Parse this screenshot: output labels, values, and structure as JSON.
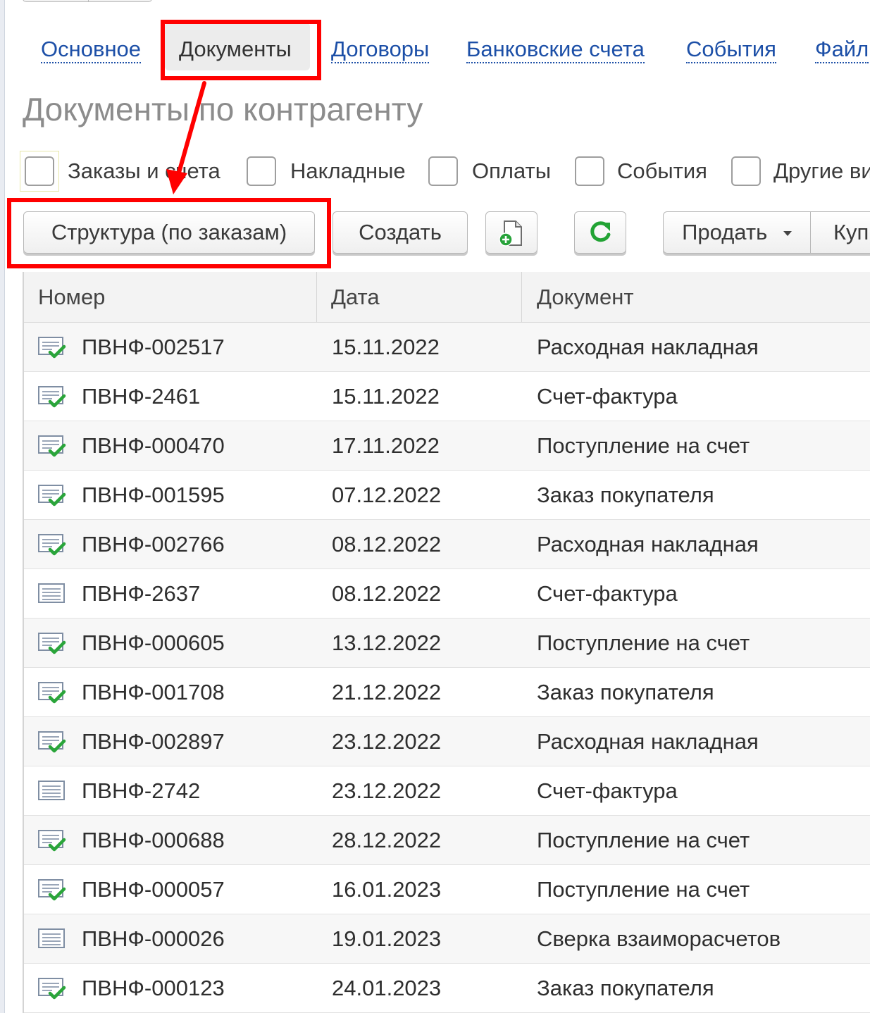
{
  "tabs": {
    "items": [
      {
        "label": "Основное",
        "active": false
      },
      {
        "label": "Документы",
        "active": true
      },
      {
        "label": "Договоры",
        "active": false
      },
      {
        "label": "Банковские счета",
        "active": false
      },
      {
        "label": "События",
        "active": false
      },
      {
        "label": "Файл",
        "active": false
      }
    ]
  },
  "page": {
    "title": "Документы по контрагенту"
  },
  "filters": [
    {
      "label": "Заказы и счета",
      "checked": false
    },
    {
      "label": "Накладные",
      "checked": false
    },
    {
      "label": "Оплаты",
      "checked": false
    },
    {
      "label": "События",
      "checked": false
    },
    {
      "label": "Другие ви",
      "checked": false
    }
  ],
  "toolbar": {
    "structure_label": "Структура (по заказам)",
    "create_label": "Создать",
    "sell_label": "Продать",
    "buy_label": "Куп",
    "sell_icon": "triangle-down",
    "add_icon": "document-plus",
    "refresh_icon": "refresh"
  },
  "table": {
    "columns": [
      "Номер",
      "Дата",
      "Документ"
    ],
    "rows": [
      {
        "icon": "doc-posted",
        "number": "ПВНФ-002517",
        "date": "15.11.2022",
        "document": "Расходная накладная"
      },
      {
        "icon": "doc-posted",
        "number": "ПВНФ-2461",
        "date": "15.11.2022",
        "document": "Счет-фактура"
      },
      {
        "icon": "doc-posted",
        "number": "ПВНФ-000470",
        "date": "17.11.2022",
        "document": "Поступление на счет"
      },
      {
        "icon": "doc-posted",
        "number": "ПВНФ-001595",
        "date": "07.12.2022",
        "document": "Заказ покупателя"
      },
      {
        "icon": "doc-posted",
        "number": "ПВНФ-002766",
        "date": "08.12.2022",
        "document": "Расходная накладная"
      },
      {
        "icon": "doc-plain",
        "number": "ПВНФ-2637",
        "date": "08.12.2022",
        "document": "Счет-фактура"
      },
      {
        "icon": "doc-posted",
        "number": "ПВНФ-000605",
        "date": "13.12.2022",
        "document": "Поступление на счет"
      },
      {
        "icon": "doc-posted",
        "number": "ПВНФ-001708",
        "date": "21.12.2022",
        "document": "Заказ покупателя"
      },
      {
        "icon": "doc-posted",
        "number": "ПВНФ-002897",
        "date": "23.12.2022",
        "document": "Расходная накладная"
      },
      {
        "icon": "doc-plain",
        "number": "ПВНФ-2742",
        "date": "23.12.2022",
        "document": "Счет-фактура"
      },
      {
        "icon": "doc-posted",
        "number": "ПВНФ-000688",
        "date": "28.12.2022",
        "document": "Поступление на счет"
      },
      {
        "icon": "doc-posted",
        "number": "ПВНФ-000057",
        "date": "16.01.2023",
        "document": "Поступление на счет"
      },
      {
        "icon": "doc-plain",
        "number": "ПВНФ-000026",
        "date": "19.01.2023",
        "document": "Сверка взаиморасчетов"
      },
      {
        "icon": "doc-posted",
        "number": "ПВНФ-000123",
        "date": "24.01.2023",
        "document": "Заказ покупателя"
      }
    ]
  },
  "annotation": {
    "color": "#ff0000"
  }
}
